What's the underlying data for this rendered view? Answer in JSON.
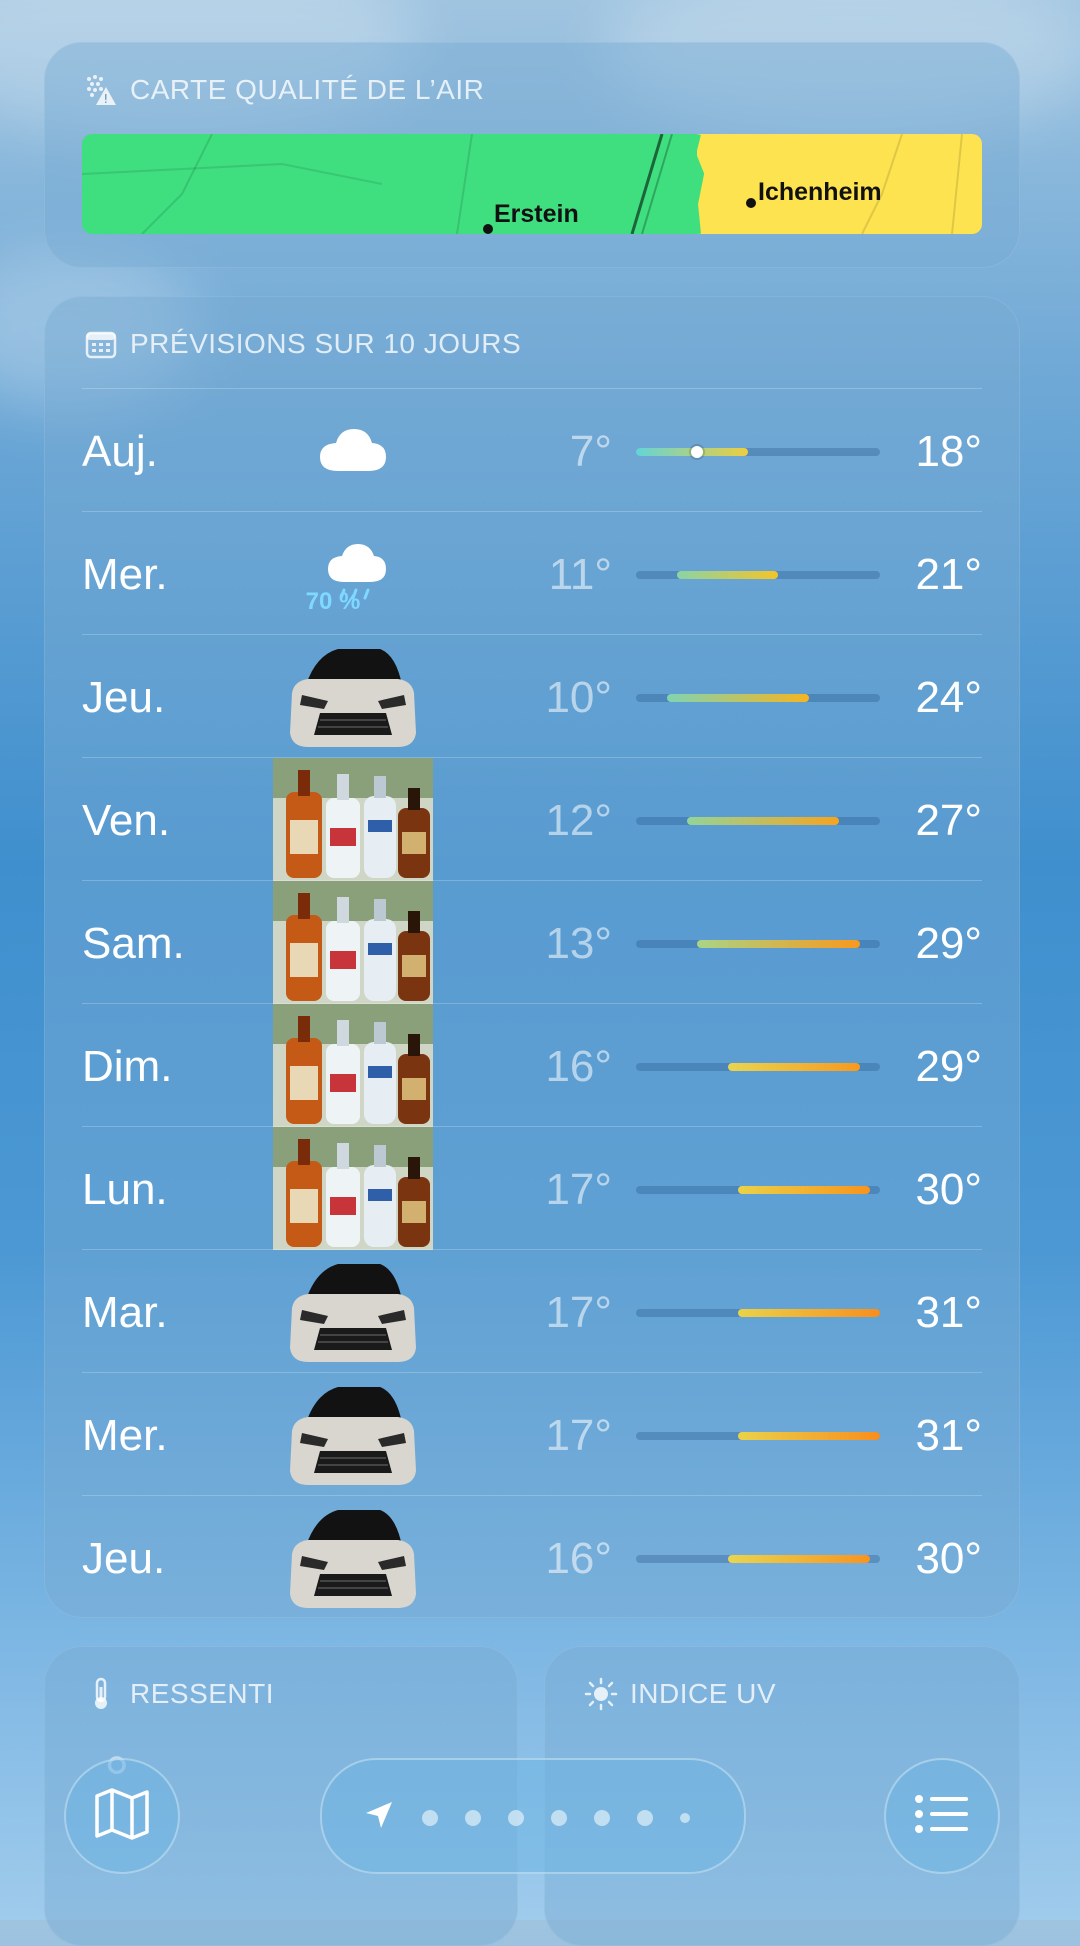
{
  "air_quality": {
    "title": "CARTE QUALITÉ DE L’AIR",
    "icon": "air-quality-map-icon",
    "towns": [
      "Erstein",
      "Ichenheim"
    ],
    "colors": {
      "good": "#3fde7f",
      "moderate": "#fde34f"
    }
  },
  "forecast": {
    "title": "PRÉVISIONS SUR 10 JOURS",
    "icon": "calendar-icon",
    "range_min": 7,
    "range_max": 31,
    "current_temp": 13,
    "days": [
      {
        "day": "Auj.",
        "icon": "cloud-icon",
        "precip": "",
        "low": "7°",
        "high": "18°",
        "low_v": 7,
        "high_v": 18
      },
      {
        "day": "Mer.",
        "icon": "rain-cloud-icon",
        "precip": "70 %",
        "low": "11°",
        "high": "21°",
        "low_v": 11,
        "high_v": 21
      },
      {
        "day": "Jeu.",
        "icon": "car-image-icon",
        "precip": "",
        "low": "10°",
        "high": "24°",
        "low_v": 10,
        "high_v": 24
      },
      {
        "day": "Ven.",
        "icon": "bottles-image-icon",
        "precip": "",
        "low": "12°",
        "high": "27°",
        "low_v": 12,
        "high_v": 27
      },
      {
        "day": "Sam.",
        "icon": "bottles-image-icon",
        "precip": "",
        "low": "13°",
        "high": "29°",
        "low_v": 13,
        "high_v": 29
      },
      {
        "day": "Dim.",
        "icon": "bottles-image-icon",
        "precip": "",
        "low": "16°",
        "high": "29°",
        "low_v": 16,
        "high_v": 29
      },
      {
        "day": "Lun.",
        "icon": "bottles-image-icon",
        "precip": "",
        "low": "17°",
        "high": "30°",
        "low_v": 17,
        "high_v": 30
      },
      {
        "day": "Mar.",
        "icon": "car-image-icon",
        "precip": "",
        "low": "17°",
        "high": "31°",
        "low_v": 17,
        "high_v": 31
      },
      {
        "day": "Mer.",
        "icon": "car-image-icon",
        "precip": "",
        "low": "17°",
        "high": "31°",
        "low_v": 17,
        "high_v": 31
      },
      {
        "day": "Jeu.",
        "icon": "car-image-icon",
        "precip": "",
        "low": "16°",
        "high": "30°",
        "low_v": 16,
        "high_v": 30
      }
    ]
  },
  "feels_like": {
    "title": "RESSENTI",
    "icon": "thermometer-icon",
    "value": "°"
  },
  "uv_index": {
    "title": "INDICE UV",
    "icon": "sun-icon"
  },
  "toolbar": {
    "map_icon": "map-icon",
    "list_icon": "list-icon",
    "location_icon": "location-arrow-icon",
    "page_count": 7,
    "active_page": 0
  }
}
